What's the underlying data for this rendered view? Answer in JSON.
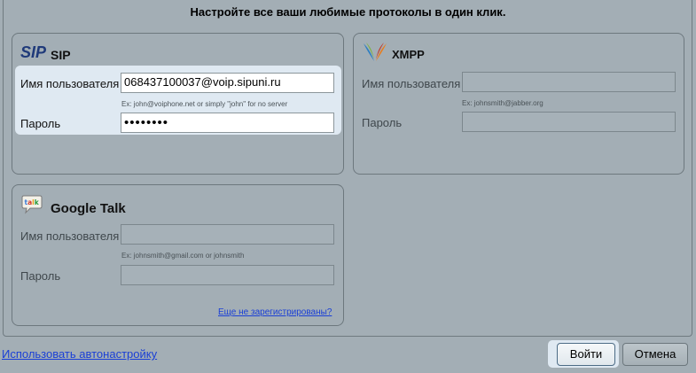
{
  "header": {
    "title": "Настройте все ваши любимые протоколы в один клик."
  },
  "sip": {
    "logo_text": "SIP",
    "title": "SIP",
    "username_label": "Имя пользователя",
    "username_value": "068437100037@voip.sipuni.ru",
    "hint": "Ex: john@voiphone.net or simply \"john\" for no server",
    "password_label": "Пароль",
    "password_value": "••••••••"
  },
  "xmpp": {
    "title": "XMPP",
    "username_label": "Имя пользователя",
    "username_value": "",
    "hint": "Ex: johnsmith@jabber.org",
    "password_label": "Пароль",
    "password_value": ""
  },
  "gtalk": {
    "logo_text": "talk",
    "title": "Google Talk",
    "username_label": "Имя пользователя",
    "username_value": "",
    "hint": "Ex: johnsmith@gmail.com or johnsmith",
    "password_label": "Пароль",
    "password_value": "",
    "register_link": "Еще не зарегистрированы?"
  },
  "footer": {
    "autoconfig_link": "Использовать автонастройку",
    "login_button": "Войти",
    "cancel_button": "Отмена"
  }
}
